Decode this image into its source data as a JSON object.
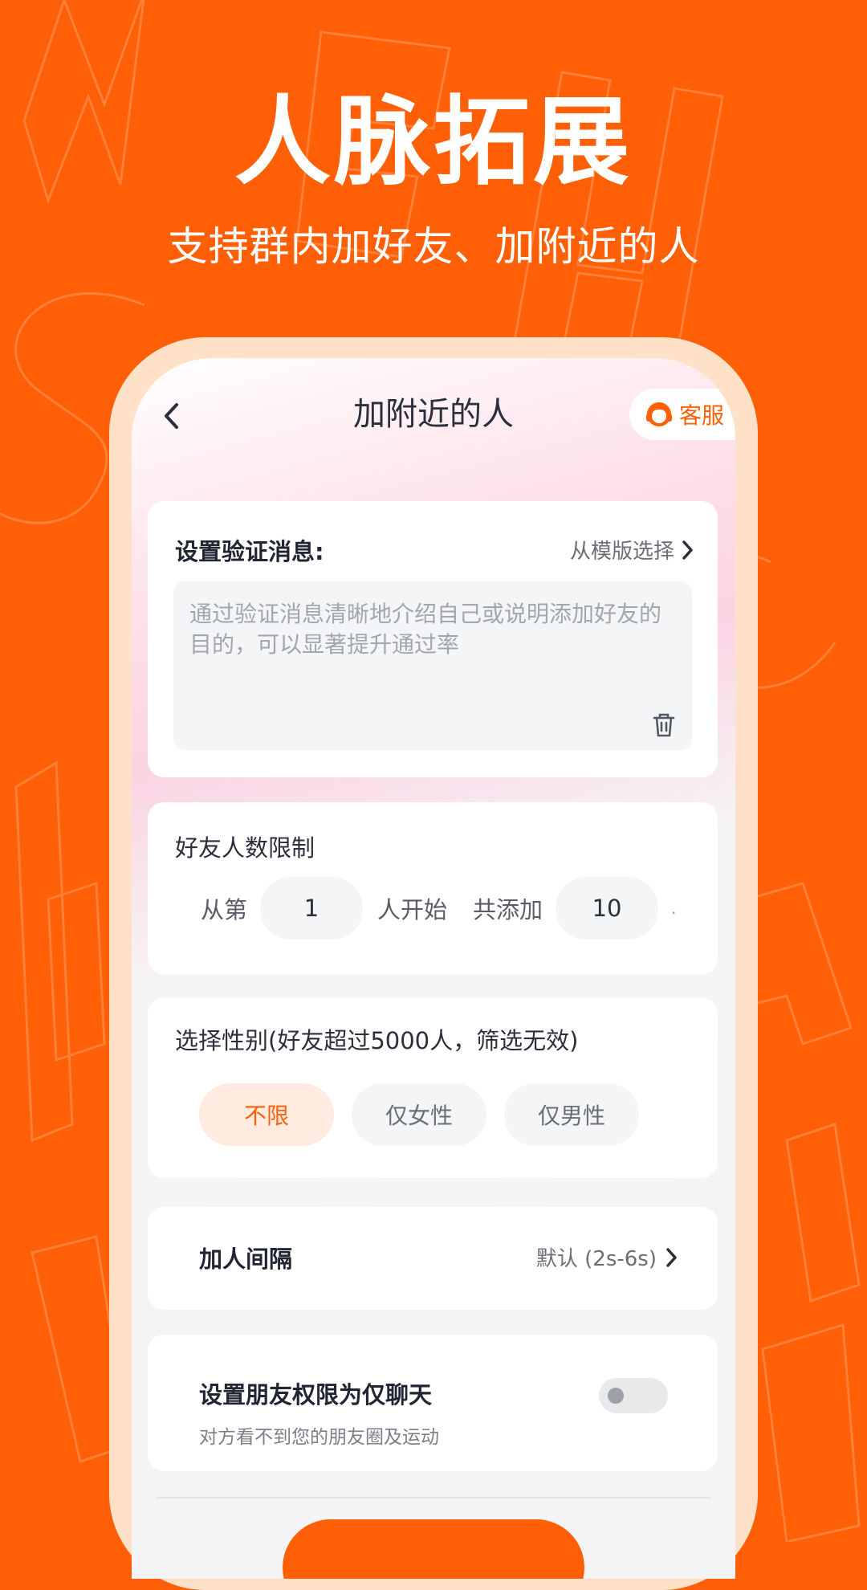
{
  "hero": {
    "title": "人脉拓展",
    "subtitle": "支持群内加好友、加附近的人"
  },
  "nav": {
    "title": "加附近的人",
    "back_icon": "chevron-left-icon",
    "service_label": "客服",
    "service_icon": "customer-service-avatar-icon"
  },
  "verify": {
    "title": "设置验证消息:",
    "template_link": "从模版选择",
    "placeholder": "通过验证消息清晰地介绍自己或说明添加好友的目的，可以显著提升通过率",
    "delete_icon": "trash-icon"
  },
  "friend_limit": {
    "title": "好友人数限制",
    "from_label": "从第",
    "start_value": "1",
    "start_suffix": "人开始",
    "total_label": "共添加",
    "total_value": "10",
    "trailing": "."
  },
  "gender": {
    "title": "选择性别(好友超过5000人，筛选无效)",
    "options": [
      "不限",
      "仅女性",
      "仅男性"
    ],
    "selected": "不限"
  },
  "interval": {
    "title": "加人间隔",
    "value": "默认 (2s-6s)"
  },
  "permission": {
    "title": "设置朋友权限为仅聊天",
    "description": "对方看不到您的朋友圈及运动",
    "enabled": false
  },
  "colors": {
    "brand": "#ff5f06",
    "background": "#ff5f06",
    "selected_chip_bg": "#ffeadf",
    "text_primary": "#222533"
  }
}
